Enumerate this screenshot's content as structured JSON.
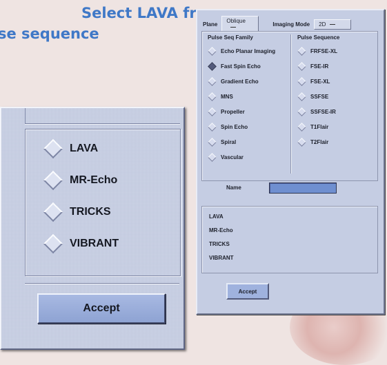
{
  "caption": {
    "line1": "Select LAVA from",
    "line2": "se sequence"
  },
  "back_window": {
    "plane_label": "Plane",
    "plane_value": "Oblique",
    "imaging_mode_label": "Imaging Mode",
    "imaging_mode_value": "2D",
    "family_header": "Pulse Seq Family",
    "sequence_header": "Pulse Sequence",
    "families": [
      {
        "label": "Echo Planar Imaging",
        "selected": false
      },
      {
        "label": "Fast Spin Echo",
        "selected": true
      },
      {
        "label": "Gradient Echo",
        "selected": false
      },
      {
        "label": "MNS",
        "selected": false
      },
      {
        "label": "Propeller",
        "selected": false
      },
      {
        "label": "Spin Echo",
        "selected": false
      },
      {
        "label": "Spiral",
        "selected": false
      },
      {
        "label": "Vascular",
        "selected": false
      }
    ],
    "sequences": [
      {
        "label": "FRFSE-XL"
      },
      {
        "label": "FSE-IR"
      },
      {
        "label": "FSE-XL"
      },
      {
        "label": "SSFSE"
      },
      {
        "label": "SSFSE-IR"
      },
      {
        "label": "T1Flair"
      },
      {
        "label": "T2Flair"
      }
    ],
    "name_label": "Name",
    "lower_list": [
      "LAVA",
      "MR-Echo",
      "TRICKS",
      "VIBRANT"
    ],
    "accept_label": "Accept"
  },
  "front_window": {
    "options": [
      {
        "label": "LAVA"
      },
      {
        "label": "MR-Echo"
      },
      {
        "label": "TRICKS"
      },
      {
        "label": "VIBRANT"
      }
    ],
    "accept_label": "Accept"
  }
}
